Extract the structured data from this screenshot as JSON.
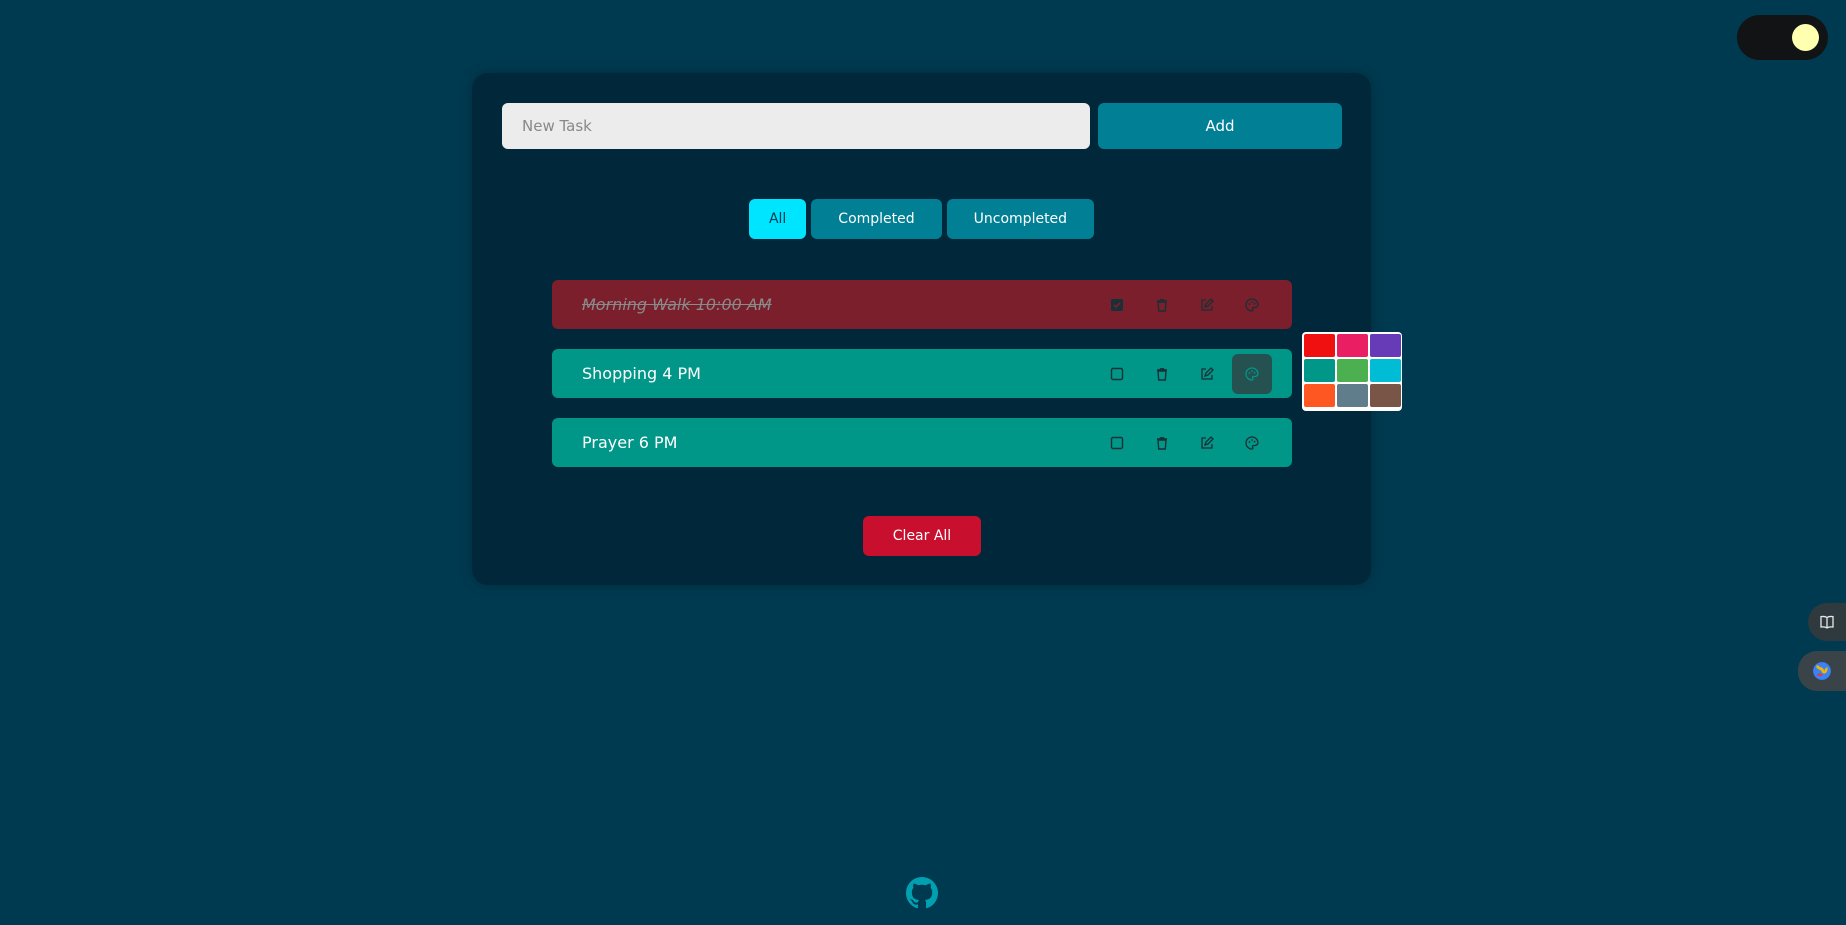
{
  "theme_toggle": {
    "state": "dark",
    "knob_color": "#ffffb0"
  },
  "new_task": {
    "placeholder": "New Task",
    "value": ""
  },
  "add_label": "Add",
  "filters": [
    {
      "label": "All",
      "active": true
    },
    {
      "label": "Completed",
      "active": false
    },
    {
      "label": "Uncompleted",
      "active": false
    }
  ],
  "tasks": [
    {
      "text": "Morning Walk 10:00 AM",
      "completed": true,
      "color": "#7a1f2b"
    },
    {
      "text": "Shopping 4 PM",
      "completed": false,
      "color": "#009688"
    },
    {
      "text": "Prayer 6 PM",
      "completed": false,
      "color": "#009688"
    }
  ],
  "task_actions": [
    "checkbox-icon",
    "trash-icon",
    "edit-icon",
    "palette-icon"
  ],
  "palette_colors": [
    "#f01010",
    "#e91e63",
    "#673ab7",
    "#009688",
    "#4caf50",
    "#00bcd4",
    "#ff5722",
    "#607d8b",
    "#795548"
  ],
  "clear_all_label": "Clear All",
  "accent": "#007f95",
  "side_icons": [
    "book-icon",
    "globe-icon"
  ],
  "footer_icon": "github-icon"
}
